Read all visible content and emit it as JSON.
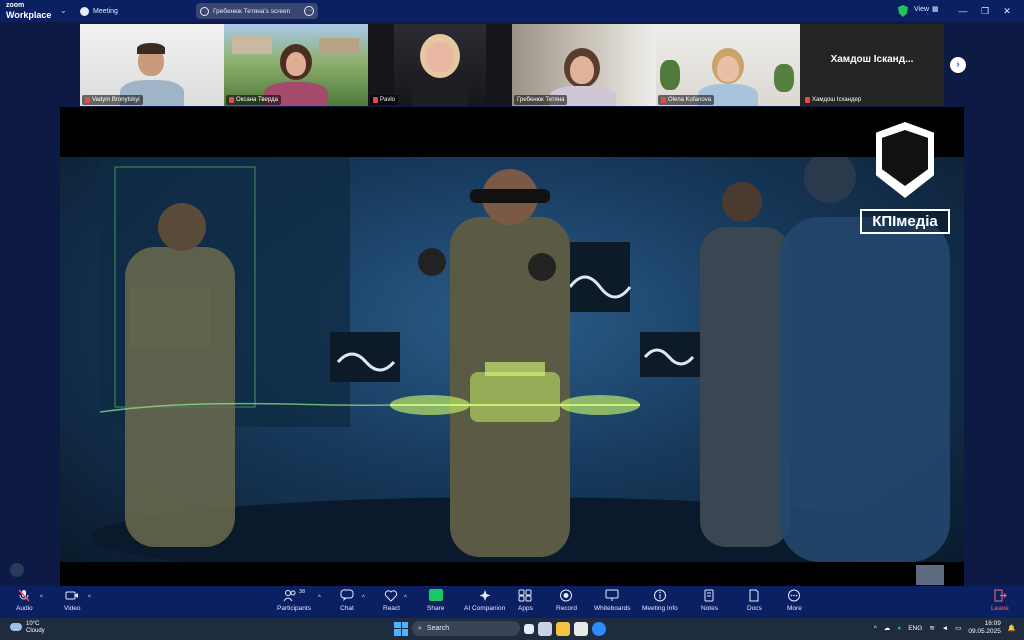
{
  "app": {
    "logo_line1": "zoom",
    "logo_line2": "Workplace",
    "meeting_label": "Meeting",
    "screen_share_label": "Гребенюк Тетяна's screen",
    "view_label": "View",
    "accent": "#0b1f63",
    "active_speaker_color": "#27d07c"
  },
  "participants": [
    {
      "name": "Vadym Bronytskyi",
      "muted": true
    },
    {
      "name": "Оксана Тверда",
      "muted": true
    },
    {
      "name": "Pavlo",
      "muted": true
    },
    {
      "name": "Гребенюк Тетяна",
      "muted": false,
      "active": true
    },
    {
      "name": "Olena Kofanova",
      "muted": true
    },
    {
      "name": "Хамдош Ісхандер",
      "muted": true,
      "video_off_label": "Хамдош Ісканд..."
    }
  ],
  "shared_screen": {
    "watermark_text": "КПІмедіа"
  },
  "toolbar": {
    "audio": "Audio",
    "video": "Video",
    "participants": "Participants",
    "participants_count": "38",
    "chat": "Chat",
    "react": "React",
    "share": "Share",
    "ai_companion": "AI Companion",
    "apps": "Apps",
    "record": "Record",
    "whiteboards": "Whiteboards",
    "meeting_info": "Meeting Info",
    "notes": "Notes",
    "docs": "Docs",
    "more": "More",
    "leave": "Leave"
  },
  "taskbar": {
    "temperature": "10°C",
    "weather": "Cloudy",
    "search_placeholder": "Search",
    "language": "ENG",
    "time": "16:09",
    "date": "09.05.2025"
  }
}
